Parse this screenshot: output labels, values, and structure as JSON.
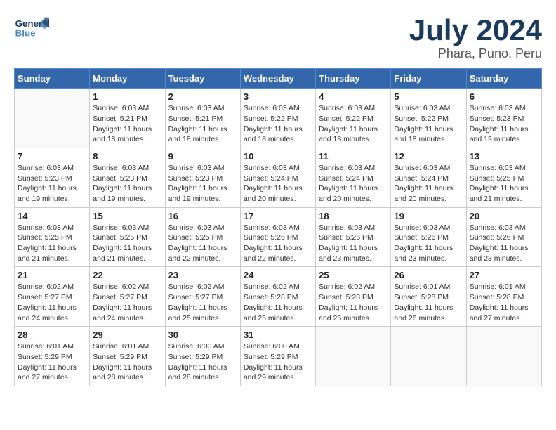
{
  "header": {
    "logo_line1": "General",
    "logo_line2": "Blue",
    "month": "July 2024",
    "location": "Phara, Puno, Peru"
  },
  "weekdays": [
    "Sunday",
    "Monday",
    "Tuesday",
    "Wednesday",
    "Thursday",
    "Friday",
    "Saturday"
  ],
  "weeks": [
    [
      {
        "day": "",
        "detail": ""
      },
      {
        "day": "1",
        "detail": "Sunrise: 6:03 AM\nSunset: 5:21 PM\nDaylight: 11 hours\nand 18 minutes."
      },
      {
        "day": "2",
        "detail": "Sunrise: 6:03 AM\nSunset: 5:21 PM\nDaylight: 11 hours\nand 18 minutes."
      },
      {
        "day": "3",
        "detail": "Sunrise: 6:03 AM\nSunset: 5:22 PM\nDaylight: 11 hours\nand 18 minutes."
      },
      {
        "day": "4",
        "detail": "Sunrise: 6:03 AM\nSunset: 5:22 PM\nDaylight: 11 hours\nand 18 minutes."
      },
      {
        "day": "5",
        "detail": "Sunrise: 6:03 AM\nSunset: 5:22 PM\nDaylight: 11 hours\nand 18 minutes."
      },
      {
        "day": "6",
        "detail": "Sunrise: 6:03 AM\nSunset: 5:23 PM\nDaylight: 11 hours\nand 19 minutes."
      }
    ],
    [
      {
        "day": "7",
        "detail": "Sunrise: 6:03 AM\nSunset: 5:23 PM\nDaylight: 11 hours\nand 19 minutes."
      },
      {
        "day": "8",
        "detail": "Sunrise: 6:03 AM\nSunset: 5:23 PM\nDaylight: 11 hours\nand 19 minutes."
      },
      {
        "day": "9",
        "detail": "Sunrise: 6:03 AM\nSunset: 5:23 PM\nDaylight: 11 hours\nand 19 minutes."
      },
      {
        "day": "10",
        "detail": "Sunrise: 6:03 AM\nSunset: 5:24 PM\nDaylight: 11 hours\nand 20 minutes."
      },
      {
        "day": "11",
        "detail": "Sunrise: 6:03 AM\nSunset: 5:24 PM\nDaylight: 11 hours\nand 20 minutes."
      },
      {
        "day": "12",
        "detail": "Sunrise: 6:03 AM\nSunset: 5:24 PM\nDaylight: 11 hours\nand 20 minutes."
      },
      {
        "day": "13",
        "detail": "Sunrise: 6:03 AM\nSunset: 5:25 PM\nDaylight: 11 hours\nand 21 minutes."
      }
    ],
    [
      {
        "day": "14",
        "detail": "Sunrise: 6:03 AM\nSunset: 5:25 PM\nDaylight: 11 hours\nand 21 minutes."
      },
      {
        "day": "15",
        "detail": "Sunrise: 6:03 AM\nSunset: 5:25 PM\nDaylight: 11 hours\nand 21 minutes."
      },
      {
        "day": "16",
        "detail": "Sunrise: 6:03 AM\nSunset: 5:25 PM\nDaylight: 11 hours\nand 22 minutes."
      },
      {
        "day": "17",
        "detail": "Sunrise: 6:03 AM\nSunset: 5:26 PM\nDaylight: 11 hours\nand 22 minutes."
      },
      {
        "day": "18",
        "detail": "Sunrise: 6:03 AM\nSunset: 5:26 PM\nDaylight: 11 hours\nand 23 minutes."
      },
      {
        "day": "19",
        "detail": "Sunrise: 6:03 AM\nSunset: 5:26 PM\nDaylight: 11 hours\nand 23 minutes."
      },
      {
        "day": "20",
        "detail": "Sunrise: 6:03 AM\nSunset: 5:26 PM\nDaylight: 11 hours\nand 23 minutes."
      }
    ],
    [
      {
        "day": "21",
        "detail": "Sunrise: 6:02 AM\nSunset: 5:27 PM\nDaylight: 11 hours\nand 24 minutes."
      },
      {
        "day": "22",
        "detail": "Sunrise: 6:02 AM\nSunset: 5:27 PM\nDaylight: 11 hours\nand 24 minutes."
      },
      {
        "day": "23",
        "detail": "Sunrise: 6:02 AM\nSunset: 5:27 PM\nDaylight: 11 hours\nand 25 minutes."
      },
      {
        "day": "24",
        "detail": "Sunrise: 6:02 AM\nSunset: 5:28 PM\nDaylight: 11 hours\nand 25 minutes."
      },
      {
        "day": "25",
        "detail": "Sunrise: 6:02 AM\nSunset: 5:28 PM\nDaylight: 11 hours\nand 26 minutes."
      },
      {
        "day": "26",
        "detail": "Sunrise: 6:01 AM\nSunset: 5:28 PM\nDaylight: 11 hours\nand 26 minutes."
      },
      {
        "day": "27",
        "detail": "Sunrise: 6:01 AM\nSunset: 5:28 PM\nDaylight: 11 hours\nand 27 minutes."
      }
    ],
    [
      {
        "day": "28",
        "detail": "Sunrise: 6:01 AM\nSunset: 5:29 PM\nDaylight: 11 hours\nand 27 minutes."
      },
      {
        "day": "29",
        "detail": "Sunrise: 6:01 AM\nSunset: 5:29 PM\nDaylight: 11 hours\nand 28 minutes."
      },
      {
        "day": "30",
        "detail": "Sunrise: 6:00 AM\nSunset: 5:29 PM\nDaylight: 11 hours\nand 28 minutes."
      },
      {
        "day": "31",
        "detail": "Sunrise: 6:00 AM\nSunset: 5:29 PM\nDaylight: 11 hours\nand 29 minutes."
      },
      {
        "day": "",
        "detail": ""
      },
      {
        "day": "",
        "detail": ""
      },
      {
        "day": "",
        "detail": ""
      }
    ]
  ]
}
